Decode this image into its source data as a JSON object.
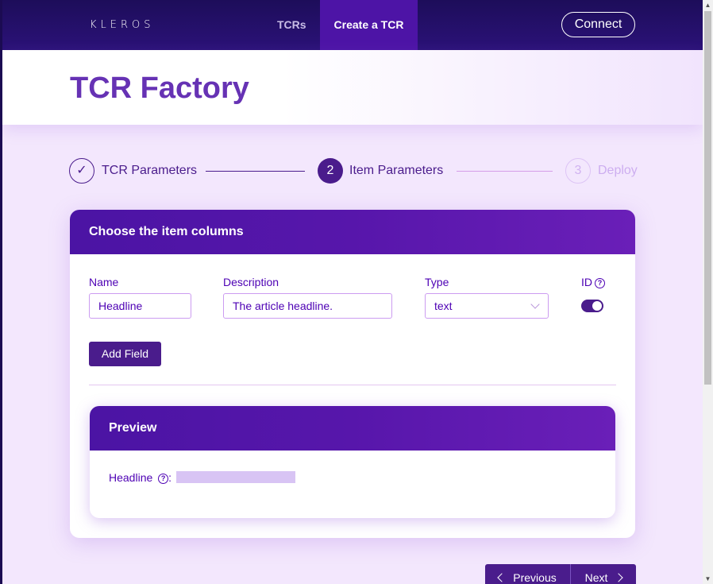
{
  "navbar": {
    "logo": "KLEROS",
    "links": [
      {
        "label": "TCRs"
      },
      {
        "label": "Create a TCR"
      }
    ],
    "connect_label": "Connect"
  },
  "header": {
    "title": "TCR Factory"
  },
  "stepper": {
    "steps": [
      {
        "number": "✓",
        "label": "TCR Parameters",
        "state": "completed"
      },
      {
        "number": "2",
        "label": "Item Parameters",
        "state": "active"
      },
      {
        "number": "3",
        "label": "Deploy",
        "state": "pending"
      }
    ]
  },
  "card": {
    "title": "Choose the item columns",
    "columns": {
      "name_label": "Name",
      "description_label": "Description",
      "type_label": "Type",
      "id_label": "ID"
    },
    "field": {
      "name": "Headline",
      "description": "The article headline.",
      "type": "text",
      "id_enabled": true
    },
    "add_field_label": "Add Field",
    "preview": {
      "title": "Preview",
      "field_label": "Headline",
      "separator": ":"
    }
  },
  "footer_nav": {
    "previous_label": "Previous",
    "next_label": "Next"
  },
  "colors": {
    "brand_dark": "#1d0d5a",
    "brand_primary": "#4a1c8c",
    "accent_purple": "#6632b4",
    "background": "#f3e7fd"
  }
}
